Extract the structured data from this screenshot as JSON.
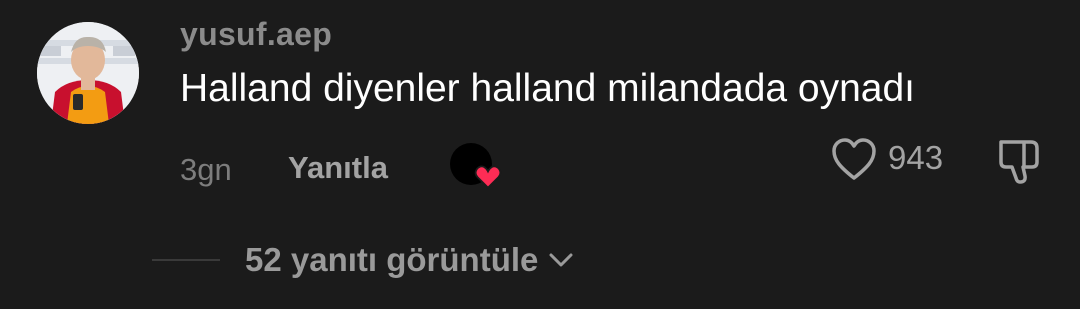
{
  "comment": {
    "username": "yusuf.aep",
    "text": "Halland diyenler halland milandada oynadı",
    "timestamp": "3gn",
    "reply_label": "Yanıtla",
    "like_count": "943",
    "creator_liked": true
  },
  "replies": {
    "view_label": "52 yanıtı görüntüle"
  },
  "icons": {
    "avatar": "avatar",
    "creator_like": "heart-icon",
    "like": "heart-outline-icon",
    "dislike": "thumbs-down-icon",
    "expand": "chevron-down-icon"
  },
  "colors": {
    "background": "#1b1b1b",
    "username": "#8b8b8b",
    "text": "#ffffff",
    "muted": "#a3a3a3",
    "heart_accent": "#fe2c55"
  }
}
